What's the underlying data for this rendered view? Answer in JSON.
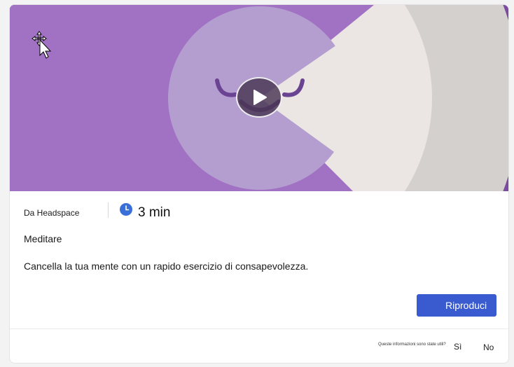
{
  "media": {
    "hero_icon": "meditation-face-illustration",
    "play_icon": "play-icon",
    "colors": {
      "outer": "#7b4aa1",
      "mid": "#a171c4",
      "inner": "#b49ed0",
      "light": "#ebe6e3",
      "accent_stroke": "#6b4393"
    }
  },
  "info": {
    "source": "Da Headspace",
    "clock_icon": "clock-icon",
    "duration": "3 min",
    "category": "Meditare",
    "description": "Cancella la tua mente con un rapido esercizio di consapevolezza."
  },
  "actions": {
    "play_label": "Riproduci",
    "accent": "#3a5bd0"
  },
  "feedback": {
    "question": "Queste informazioni sono state utili?",
    "yes": "Sì",
    "no": "No"
  },
  "cursor": {
    "icon": "move-cursor-icon"
  }
}
